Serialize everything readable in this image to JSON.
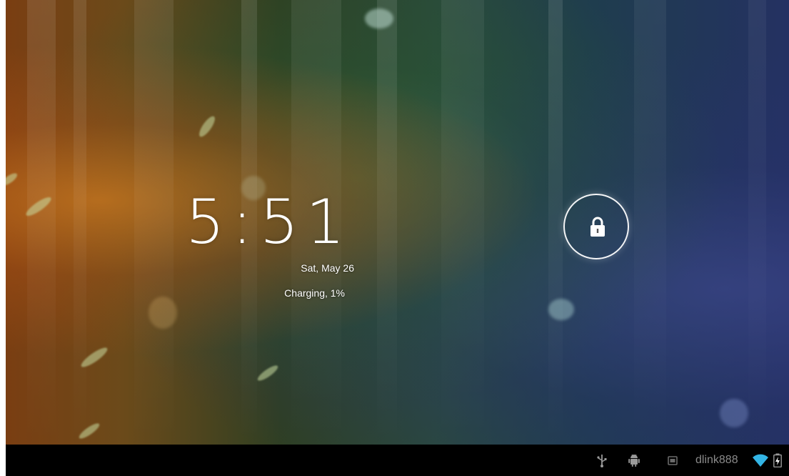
{
  "lockscreen": {
    "time": "5:51",
    "date": "Sat, May 26",
    "battery_status": "Charging, 1%",
    "unlock_icon": "lock-icon"
  },
  "statusbar": {
    "icons": [
      "usb-icon",
      "android-debug-icon",
      "notification-icon",
      "wifi-icon",
      "battery-charging-icon"
    ],
    "network_name": "dlink888"
  },
  "colors": {
    "wifi": "#33b5e5",
    "statusbar_text": "#8a8a8a",
    "statusbar_bg": "#000000"
  }
}
